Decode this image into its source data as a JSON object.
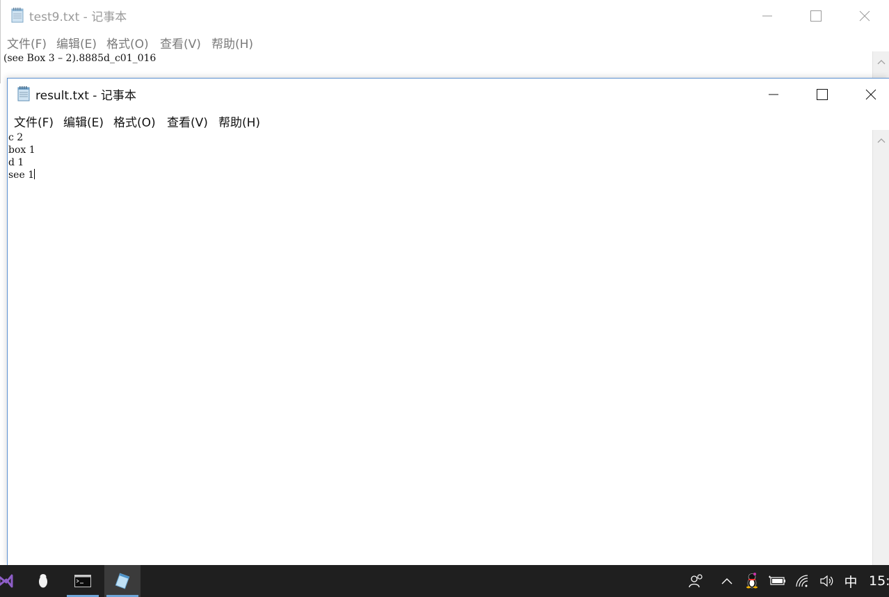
{
  "back_window": {
    "title": "test9.txt - 记事本",
    "menu": [
      "文件(F)",
      "编辑(E)",
      "格式(O)",
      "查看(V)",
      "帮助(H)"
    ],
    "content_line": "(see Box 3 – 2).8885d_c01_016"
  },
  "front_window": {
    "title": "result.txt - 记事本",
    "menu": [
      "文件(F)",
      "编辑(E)",
      "格式(O)",
      "查看(V)",
      "帮助(H)"
    ],
    "lines": [
      "c 2",
      "box 1",
      "d 1",
      "see 1"
    ]
  },
  "taskbar": {
    "apps": [
      {
        "icon": "visual-studio-icon"
      },
      {
        "icon": "qq-penguin-icon"
      },
      {
        "icon": "command-prompt-icon"
      },
      {
        "icon": "notepad-icon"
      }
    ],
    "tray": {
      "ime": "中",
      "clock": "15:"
    }
  },
  "colors": {
    "taskbar_bg": "#1f1f1f",
    "active_border": "#5a8fd0",
    "running_indicator": "#6fa6d9"
  }
}
